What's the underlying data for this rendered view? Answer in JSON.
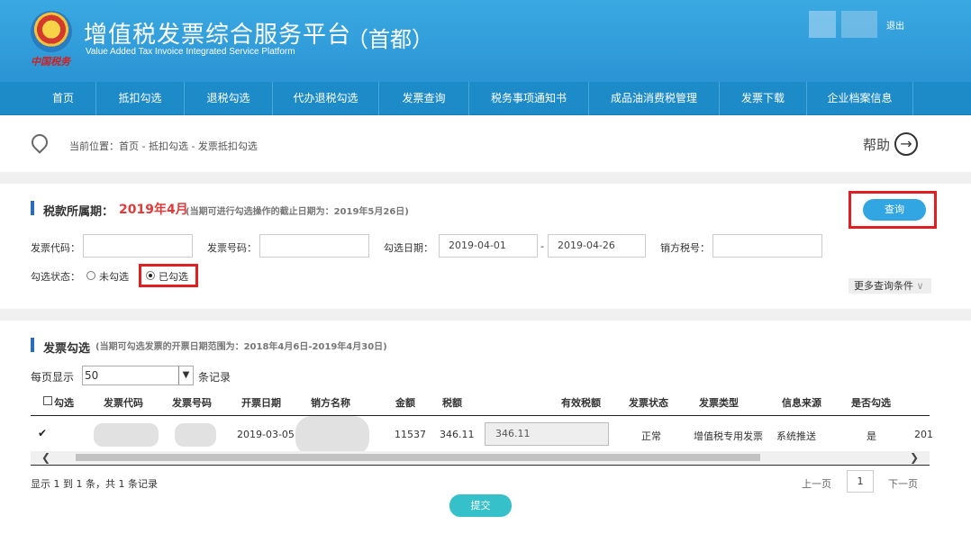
{
  "header": {
    "emblem_tag": "中国税务",
    "title": "增值税发票综合服务平台",
    "subtitle": "Value Added Tax Invoice Integrated Service Platform",
    "region": "（首都）",
    "logout": "退出"
  },
  "nav": {
    "items": [
      {
        "label": "首页"
      },
      {
        "label": "抵扣勾选"
      },
      {
        "label": "退税勾选"
      },
      {
        "label": "代办退税勾选"
      },
      {
        "label": "发票查询"
      },
      {
        "label": "税务事项通知书"
      },
      {
        "label": "成品油消费税管理"
      },
      {
        "label": "发票下载"
      },
      {
        "label": "企业档案信息"
      }
    ]
  },
  "breadcrumb": {
    "prefix": "当前位置：",
    "path": "首页 - 抵扣勾选 - 发票抵扣勾选"
  },
  "help": {
    "label": "帮助"
  },
  "tax_period": {
    "label": "税款所属期：",
    "value": "2019年4月",
    "note": "(当期可进行勾选操作的截止日期为：2019年5月26日)"
  },
  "query": {
    "label": "查询"
  },
  "filters": {
    "invoice_code_label": "发票代码：",
    "invoice_code_value": "",
    "invoice_number_label": "发票号码：",
    "invoice_number_value": "",
    "date_label": "勾选日期：",
    "date_from": "2019-04-01",
    "date_sep": "-",
    "date_to": "2019-04-26",
    "seller_tax_label": "销方税号：",
    "seller_tax_value": "",
    "status_label": "勾选状态：",
    "status_unchecked": "未勾选",
    "status_checked": "已勾选",
    "more": "更多查询条件"
  },
  "invoice_section": {
    "label": "发票勾选",
    "note": "(当期可勾选发票的开票日期范围为：2018年4月6日-2019年4月30日)",
    "per_page_label": "每页显示",
    "per_page_value": "50",
    "records_label": "条记录"
  },
  "table": {
    "headers": [
      "勾选",
      "发票代码",
      "发票号码",
      "开票日期",
      "销方名称",
      "金额",
      "税额",
      "有效税额",
      "发票状态",
      "发票类型",
      "信息来源",
      "是否勾选"
    ],
    "row": {
      "checked": true,
      "date": "2019-03-05",
      "amount": "11537",
      "tax": "346.11",
      "effective_tax": "346.11",
      "status": "正常",
      "type": "增值税专用发票",
      "source": "系统推送",
      "selected": "是",
      "overflow": "201"
    }
  },
  "pagination": {
    "info": "显示 1 到 1 条，共 1 条记录",
    "prev": "上一页",
    "current": "1",
    "next": "下一页"
  },
  "submit": {
    "label": "提交"
  }
}
